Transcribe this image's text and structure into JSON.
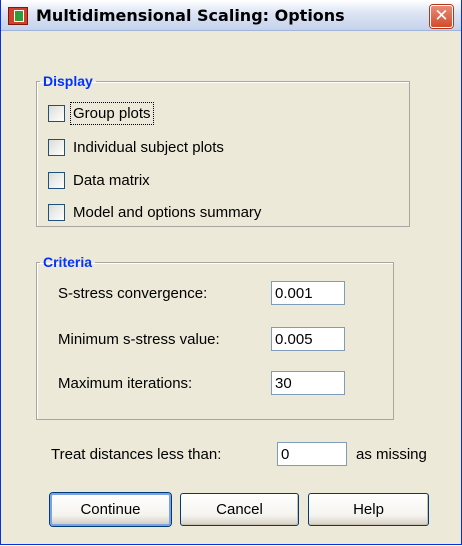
{
  "window": {
    "title": "Multidimensional Scaling: Options",
    "close_glyph": "✕",
    "title_icon": "spss-dialog-icon",
    "accent": "#0033ff"
  },
  "display": {
    "legend": "Display",
    "items": [
      {
        "label": "Group plots",
        "checked": false,
        "focused": true
      },
      {
        "label": "Individual subject plots",
        "checked": false
      },
      {
        "label": "Data matrix",
        "checked": false
      },
      {
        "label": "Model and options summary",
        "checked": false
      }
    ]
  },
  "criteria": {
    "legend": "Criteria",
    "sstress_label": "S-stress convergence:",
    "sstress_value": "0.001",
    "min_sstress_label": "Minimum s-stress value:",
    "min_sstress_value": "0.005",
    "max_iter_label": "Maximum iterations:",
    "max_iter_value": "30"
  },
  "missing": {
    "label": "Treat distances less than:",
    "value": "0",
    "suffix": "as missing"
  },
  "buttons": {
    "continue": "Continue",
    "cancel": "Cancel",
    "help": "Help"
  }
}
